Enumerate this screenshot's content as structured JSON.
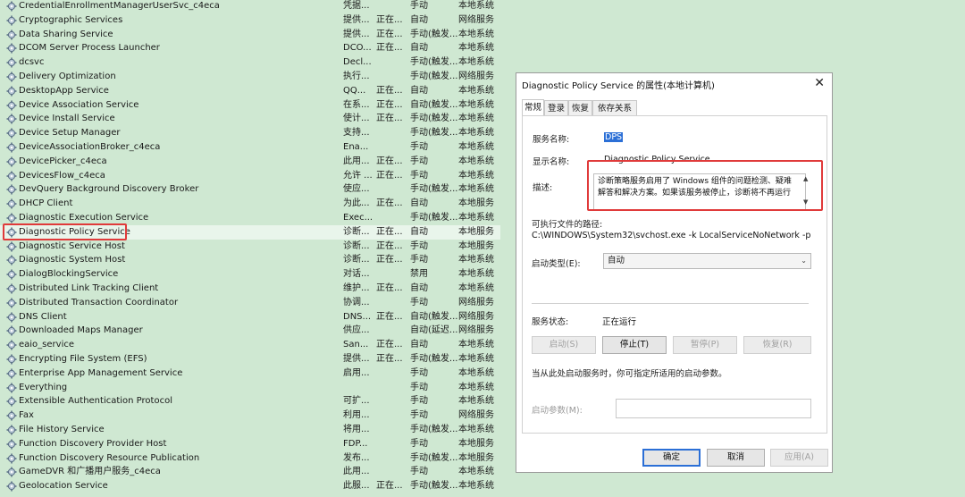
{
  "services": [
    {
      "name": "CredentialEnrollmentManagerUserSvc_c4eca",
      "desc": "凭据...",
      "status": "",
      "startup": "手动",
      "logon": "本地系统"
    },
    {
      "name": "Cryptographic Services",
      "desc": "提供...",
      "status": "正在...",
      "startup": "自动",
      "logon": "网络服务"
    },
    {
      "name": "Data Sharing Service",
      "desc": "提供...",
      "status": "正在...",
      "startup": "手动(触发...",
      "logon": "本地系统"
    },
    {
      "name": "DCOM Server Process Launcher",
      "desc": "DCO...",
      "status": "正在...",
      "startup": "自动",
      "logon": "本地系统"
    },
    {
      "name": "dcsvc",
      "desc": "Decl...",
      "status": "",
      "startup": "手动(触发...",
      "logon": "本地系统"
    },
    {
      "name": "Delivery Optimization",
      "desc": "执行...",
      "status": "",
      "startup": "手动(触发...",
      "logon": "网络服务"
    },
    {
      "name": "DesktopApp Service",
      "desc": "QQ...",
      "status": "正在...",
      "startup": "自动",
      "logon": "本地系统"
    },
    {
      "name": "Device Association Service",
      "desc": "在系...",
      "status": "正在...",
      "startup": "自动(触发...",
      "logon": "本地系统"
    },
    {
      "name": "Device Install Service",
      "desc": "使计...",
      "status": "正在...",
      "startup": "手动(触发...",
      "logon": "本地系统"
    },
    {
      "name": "Device Setup Manager",
      "desc": "支持...",
      "status": "",
      "startup": "手动(触发...",
      "logon": "本地系统"
    },
    {
      "name": "DeviceAssociationBroker_c4eca",
      "desc": "Ena...",
      "status": "",
      "startup": "手动",
      "logon": "本地系统"
    },
    {
      "name": "DevicePicker_c4eca",
      "desc": "此用...",
      "status": "正在...",
      "startup": "手动",
      "logon": "本地系统"
    },
    {
      "name": "DevicesFlow_c4eca",
      "desc": "允许 ...",
      "status": "正在...",
      "startup": "手动",
      "logon": "本地系统"
    },
    {
      "name": "DevQuery Background Discovery Broker",
      "desc": "使应...",
      "status": "",
      "startup": "手动(触发...",
      "logon": "本地系统"
    },
    {
      "name": "DHCP Client",
      "desc": "为此...",
      "status": "正在...",
      "startup": "自动",
      "logon": "本地服务"
    },
    {
      "name": "Diagnostic Execution Service",
      "desc": "Exec...",
      "status": "",
      "startup": "手动(触发...",
      "logon": "本地系统"
    },
    {
      "name": "Diagnostic Policy Service",
      "desc": "诊断...",
      "status": "正在...",
      "startup": "自动",
      "logon": "本地服务"
    },
    {
      "name": "Diagnostic Service Host",
      "desc": "诊断...",
      "status": "正在...",
      "startup": "手动",
      "logon": "本地服务"
    },
    {
      "name": "Diagnostic System Host",
      "desc": "诊断...",
      "status": "正在...",
      "startup": "手动",
      "logon": "本地系统"
    },
    {
      "name": "DialogBlockingService",
      "desc": "对话...",
      "status": "",
      "startup": "禁用",
      "logon": "本地系统"
    },
    {
      "name": "Distributed Link Tracking Client",
      "desc": "维护...",
      "status": "正在...",
      "startup": "自动",
      "logon": "本地系统"
    },
    {
      "name": "Distributed Transaction Coordinator",
      "desc": "协调...",
      "status": "",
      "startup": "手动",
      "logon": "网络服务"
    },
    {
      "name": "DNS Client",
      "desc": "DNS...",
      "status": "正在...",
      "startup": "自动(触发...",
      "logon": "网络服务"
    },
    {
      "name": "Downloaded Maps Manager",
      "desc": "供应...",
      "status": "",
      "startup": "自动(延迟...",
      "logon": "网络服务"
    },
    {
      "name": "eaio_service",
      "desc": "San...",
      "status": "正在...",
      "startup": "自动",
      "logon": "本地系统"
    },
    {
      "name": "Encrypting File System (EFS)",
      "desc": "提供...",
      "status": "正在...",
      "startup": "手动(触发...",
      "logon": "本地系统"
    },
    {
      "name": "Enterprise App Management Service",
      "desc": "启用...",
      "status": "",
      "startup": "手动",
      "logon": "本地系统"
    },
    {
      "name": "Everything",
      "desc": "",
      "status": "",
      "startup": "手动",
      "logon": "本地系统"
    },
    {
      "name": "Extensible Authentication Protocol",
      "desc": "可扩...",
      "status": "",
      "startup": "手动",
      "logon": "本地系统"
    },
    {
      "name": "Fax",
      "desc": "利用...",
      "status": "",
      "startup": "手动",
      "logon": "网络服务"
    },
    {
      "name": "File History Service",
      "desc": "将用...",
      "status": "",
      "startup": "手动(触发...",
      "logon": "本地系统"
    },
    {
      "name": "Function Discovery Provider Host",
      "desc": "FDP...",
      "status": "",
      "startup": "手动",
      "logon": "本地服务"
    },
    {
      "name": "Function Discovery Resource Publication",
      "desc": "发布...",
      "status": "",
      "startup": "手动(触发...",
      "logon": "本地服务"
    },
    {
      "name": "GameDVR 和广播用户服务_c4eca",
      "desc": "此用...",
      "status": "",
      "startup": "手动",
      "logon": "本地系统"
    },
    {
      "name": "Geolocation Service",
      "desc": "此服...",
      "status": "正在...",
      "startup": "手动(触发...",
      "logon": "本地系统"
    }
  ],
  "dialog": {
    "title": "Diagnostic Policy Service 的属性(本地计算机)",
    "tabs": [
      "常规",
      "登录",
      "恢复",
      "依存关系"
    ],
    "service_name_label": "服务名称:",
    "service_name_value": "DPS",
    "display_name_label": "显示名称:",
    "display_name_value": "Diagnostic Policy Service",
    "description_label": "描述:",
    "description_value": "诊断策略服务启用了 Windows 组件的问题检测、疑难解答和解决方案。如果该服务被停止，诊断将不再运行",
    "path_label": "可执行文件的路径:",
    "path_value": "C:\\WINDOWS\\System32\\svchost.exe -k LocalServiceNoNetwork -p",
    "startup_type_label": "启动类型(E):",
    "startup_type_value": "自动",
    "status_label": "服务状态:",
    "status_value": "正在运行",
    "buttons": {
      "start": "启动(S)",
      "stop": "停止(T)",
      "pause": "暂停(P)",
      "resume": "恢复(R)"
    },
    "hint": "当从此处启动服务时，你可指定所适用的启动参数。",
    "start_params_label": "启动参数(M):",
    "start_params_value": "",
    "footer": {
      "ok": "确定",
      "cancel": "取消",
      "apply": "应用(A)"
    }
  }
}
